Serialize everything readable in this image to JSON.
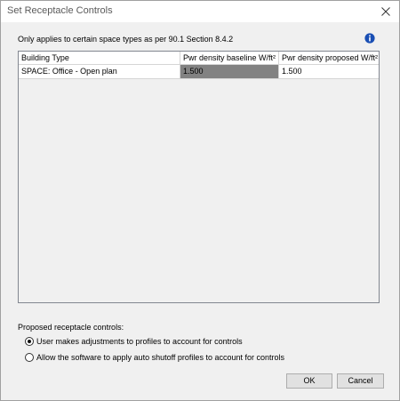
{
  "window": {
    "title": "Set Receptacle Controls"
  },
  "note": "Only applies to certain space types as per 90.1 Section 8.4.2",
  "grid": {
    "columns": [
      "Building Type",
      "Pwr density baseline W/ft²",
      "Pwr density proposed W/ft²"
    ],
    "rows": [
      {
        "building_type": "SPACE: Office - Open plan",
        "baseline": "1.500",
        "proposed": "1.500"
      }
    ]
  },
  "controls": {
    "group_label": "Proposed receptacle controls:",
    "options": [
      {
        "label": "User makes adjustments to profiles to account for controls",
        "selected": true
      },
      {
        "label": "Allow the software to apply auto shutoff profiles to account for controls",
        "selected": false
      }
    ]
  },
  "buttons": {
    "ok": "OK",
    "cancel": "Cancel"
  },
  "icons": {
    "info": "info-icon",
    "close": "close-icon"
  },
  "colors": {
    "selected_cell": "#828282",
    "info_blue": "#1a4fb4"
  }
}
